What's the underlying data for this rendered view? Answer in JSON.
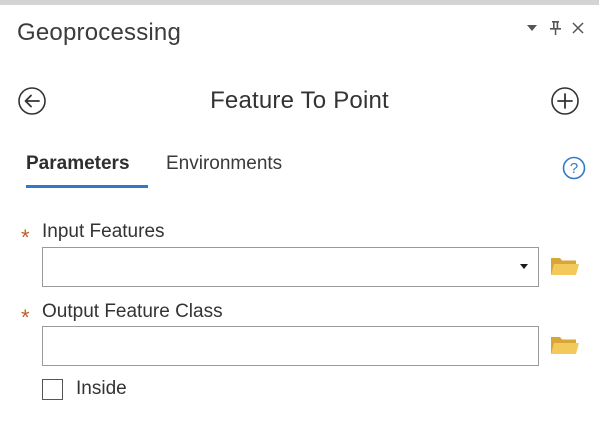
{
  "pane": {
    "title": "Geoprocessing"
  },
  "tool": {
    "title": "Feature To Point"
  },
  "tabs": {
    "parameters": "Parameters",
    "environments": "Environments"
  },
  "fields": {
    "input_features": {
      "label": "Input Features",
      "value": "",
      "required_marker": "*"
    },
    "output_feature_class": {
      "label": "Output Feature Class",
      "value": "",
      "required_marker": "*"
    },
    "inside": {
      "label": "Inside",
      "checked": false
    }
  },
  "icons": {
    "title_controls": [
      "chevron-down-icon",
      "pin-icon",
      "close-icon"
    ],
    "back": "back-arrow-circle-icon",
    "add": "add-circle-icon",
    "help": "help-circle-icon",
    "browse": "folder-icon"
  },
  "colors": {
    "accent": "#2f7ac6",
    "required": "#c55a2b",
    "folder": "#e8b84a"
  }
}
